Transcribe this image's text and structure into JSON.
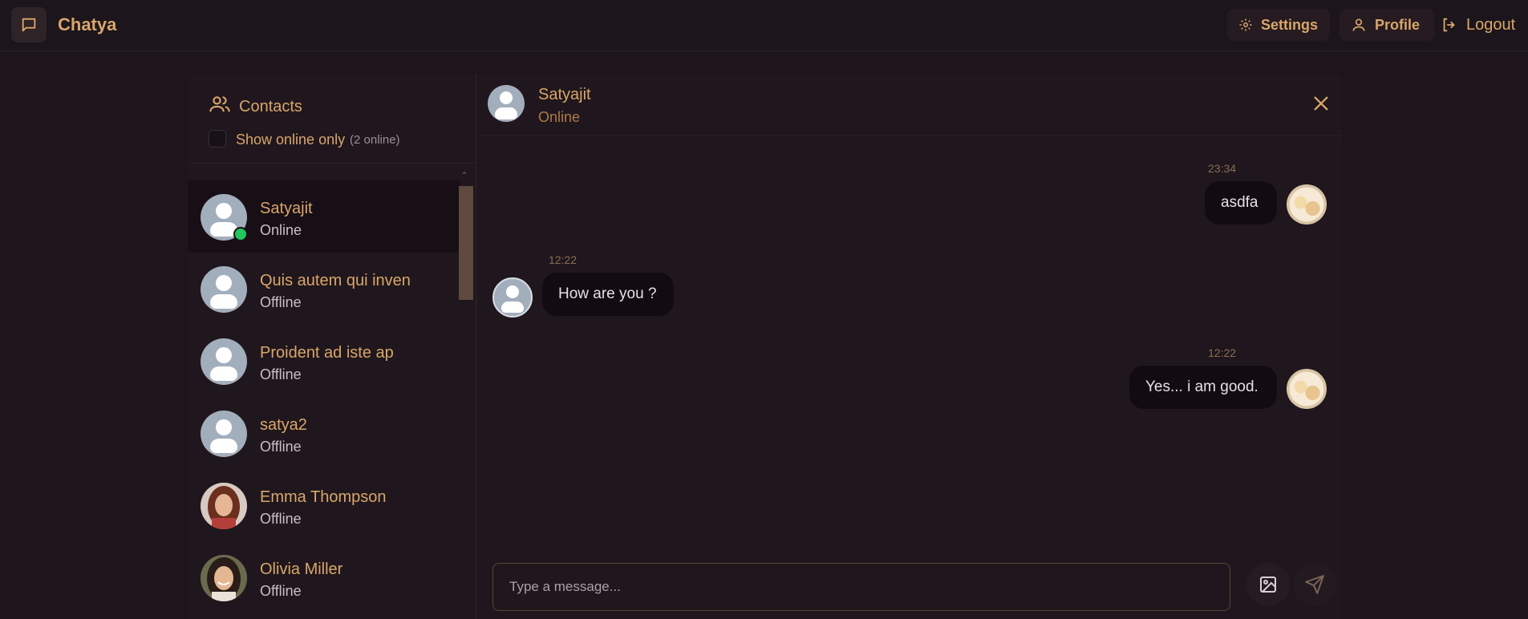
{
  "app": {
    "name": "Chatya"
  },
  "nav": {
    "settings": "Settings",
    "profile": "Profile",
    "logout": "Logout"
  },
  "sidebar": {
    "title": "Contacts",
    "online_filter_label": "Show online only",
    "online_count": "(2 online)",
    "contacts": [
      {
        "name": "Satyajit",
        "status": "Online"
      },
      {
        "name": "Quis autem qui inven",
        "status": "Offline"
      },
      {
        "name": "Proident ad iste ap",
        "status": "Offline"
      },
      {
        "name": "satya2",
        "status": "Offline"
      },
      {
        "name": "Emma Thompson",
        "status": "Offline"
      },
      {
        "name": "Olivia Miller",
        "status": "Offline"
      }
    ]
  },
  "chat": {
    "name": "Satyajit",
    "status": "Online",
    "messages": [
      {
        "time": "23:34",
        "text": "asdfa",
        "from": "me"
      },
      {
        "time": "12:22",
        "text": "How are you ?",
        "from": "them"
      },
      {
        "time": "12:22",
        "text": "Yes... i am good.",
        "from": "me"
      }
    ],
    "input_placeholder": "Type a message..."
  },
  "colors": {
    "accent": "#d9a66a",
    "background": "#1e151c",
    "online": "#22c55e"
  }
}
